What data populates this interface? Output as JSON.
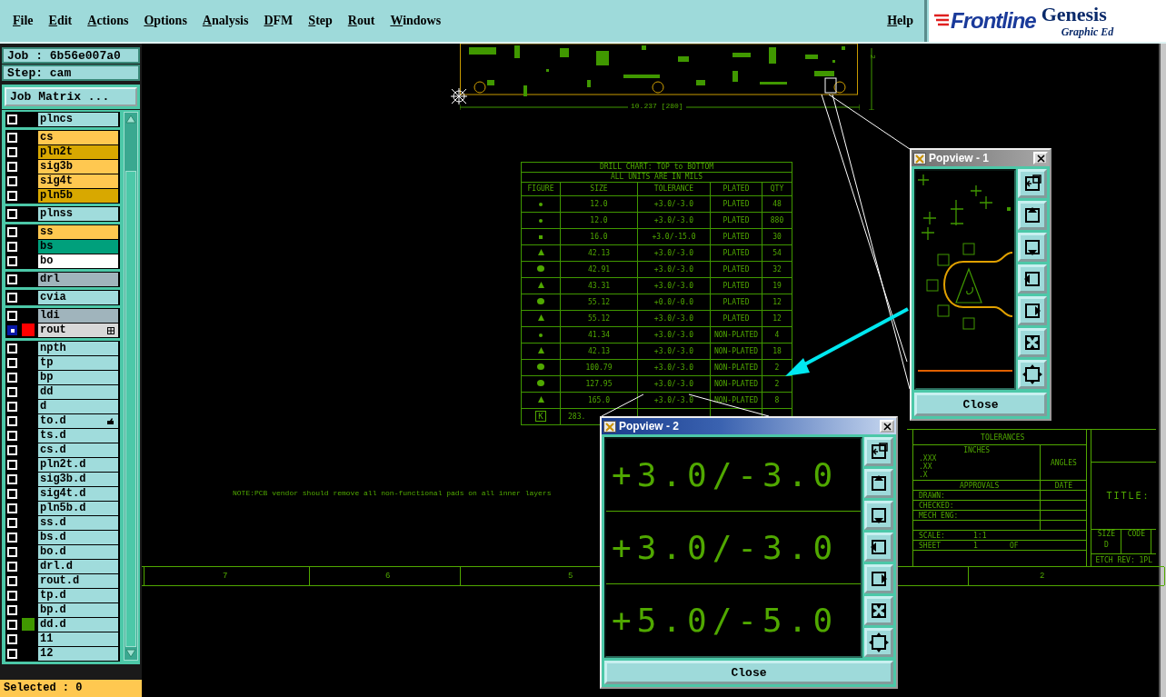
{
  "menu": {
    "items": [
      "File",
      "Edit",
      "Actions",
      "Options",
      "Analysis",
      "DFM",
      "Step",
      "Rout",
      "Windows"
    ],
    "help": "Help"
  },
  "logo": {
    "brand": "Frontline",
    "product": "Genesis",
    "subtitle": "Graphic Ed"
  },
  "job": {
    "job": "Job : 6b56e007a0",
    "step": "Step: cam",
    "matrix_button": "Job Matrix ..."
  },
  "layer_groups": [
    {
      "layers": [
        {
          "name": "plncs",
          "color": "#a0dcdc",
          "active": false
        }
      ]
    },
    {
      "layers": [
        {
          "name": "cs",
          "color": "#ffc850",
          "active": false
        },
        {
          "name": "pln2t",
          "color": "#d8a800",
          "active": false
        },
        {
          "name": "sig3b",
          "color": "#ffc850",
          "active": false
        },
        {
          "name": "sig4t",
          "color": "#ffc850",
          "active": false
        },
        {
          "name": "pln5b",
          "color": "#d8a800",
          "active": false
        }
      ]
    },
    {
      "layers": [
        {
          "name": "plnss",
          "color": "#a0dcdc",
          "active": false
        }
      ]
    },
    {
      "layers": [
        {
          "name": "ss",
          "color": "#ffc850",
          "active": false
        },
        {
          "name": "bs",
          "color": "#00a07c",
          "active": false
        },
        {
          "name": "bo",
          "color": "#ffffff",
          "active": false
        }
      ]
    },
    {
      "layers": [
        {
          "name": "drl",
          "color": "#a0b4bc",
          "active": false
        }
      ]
    },
    {
      "layers": [
        {
          "name": "cvia",
          "color": "#a0dcdc",
          "active": false
        }
      ]
    },
    {
      "layers": [
        {
          "name": "ldi",
          "color": "#a0b4bc",
          "active": false
        },
        {
          "name": "rout",
          "color": "#d8d8d8",
          "active": true,
          "swatch": {
            "color": "#ff0000"
          },
          "kind": "grid-mark"
        }
      ]
    },
    {
      "layers": [
        {
          "name": "npth",
          "color": "#a0dcdc",
          "active": false
        },
        {
          "name": "tp",
          "color": "#a0dcdc",
          "active": false
        },
        {
          "name": "bp",
          "color": "#a0dcdc",
          "active": false
        },
        {
          "name": "dd",
          "color": "#a0dcdc",
          "active": false
        },
        {
          "name": "d",
          "color": "#a0dcdc",
          "active": false
        },
        {
          "name": "to.d",
          "color": "#a0dcdc",
          "active": false,
          "kind": "hand-mark"
        },
        {
          "name": "ts.d",
          "color": "#a0dcdc",
          "active": false
        },
        {
          "name": "cs.d",
          "color": "#a0dcdc",
          "active": false
        },
        {
          "name": "pln2t.d",
          "color": "#a0dcdc",
          "active": false
        },
        {
          "name": "sig3b.d",
          "color": "#a0dcdc",
          "active": false
        },
        {
          "name": "sig4t.d",
          "color": "#a0dcdc",
          "active": false
        },
        {
          "name": "pln5b.d",
          "color": "#a0dcdc",
          "active": false
        },
        {
          "name": "ss.d",
          "color": "#a0dcdc",
          "active": false
        },
        {
          "name": "bs.d",
          "color": "#a0dcdc",
          "active": false
        },
        {
          "name": "bo.d",
          "color": "#a0dcdc",
          "active": false
        },
        {
          "name": "drl.d",
          "color": "#a0dcdc",
          "active": false
        },
        {
          "name": "rout.d",
          "color": "#a0dcdc",
          "active": false
        },
        {
          "name": "tp.d",
          "color": "#a0dcdc",
          "active": false
        },
        {
          "name": "bp.d",
          "color": "#a0dcdc",
          "active": false
        },
        {
          "name": "dd.d",
          "color": "#a0dcdc",
          "active": false,
          "swatch": {
            "color": "#409800"
          }
        },
        {
          "name": "11",
          "color": "#a0dcdc",
          "active": false
        },
        {
          "name": "12",
          "color": "#a0dcdc",
          "active": false
        }
      ]
    }
  ],
  "selected_status": "Selected : 0",
  "board": {
    "dimension": "10.237 [280]",
    "side_label": "2"
  },
  "drill_chart": {
    "title": "DRILL CHART: TOP to BOTTOM",
    "subtitle": "ALL UNITS ARE IN MILS",
    "columns": [
      "FIGURE",
      "SIZE",
      "TOLERANCE",
      "PLATED",
      "QTY"
    ],
    "rows": [
      {
        "kind": "small-dot",
        "size": "12.0",
        "tolerance": "+3.0/-3.0",
        "plated": "PLATED",
        "qty": "48"
      },
      {
        "kind": "small-dot",
        "size": "12.0",
        "tolerance": "+3.0/-3.0",
        "plated": "PLATED",
        "qty": "880"
      },
      {
        "kind": "square",
        "size": "16.0",
        "tolerance": "+3.0/-15.0",
        "plated": "PLATED",
        "qty": "30"
      },
      {
        "kind": "triangle",
        "size": "42.13",
        "tolerance": "+3.0/-3.0",
        "plated": "PLATED",
        "qty": "54"
      },
      {
        "kind": "blob",
        "size": "42.91",
        "tolerance": "+3.0/-3.0",
        "plated": "PLATED",
        "qty": "32"
      },
      {
        "kind": "triangle",
        "size": "43.31",
        "tolerance": "+3.0/-3.0",
        "plated": "PLATED",
        "qty": "19"
      },
      {
        "kind": "blob",
        "size": "55.12",
        "tolerance": "+0.0/-0.0",
        "plated": "PLATED",
        "qty": "12"
      },
      {
        "kind": "triangle",
        "size": "55.12",
        "tolerance": "+3.0/-3.0",
        "plated": "PLATED",
        "qty": "12"
      },
      {
        "kind": "small-dot",
        "size": "41.34",
        "tolerance": "+3.0/-3.0",
        "plated": "NON-PLATED",
        "qty": "4"
      },
      {
        "kind": "triangle",
        "size": "42.13",
        "tolerance": "+3.0/-3.0",
        "plated": "NON-PLATED",
        "qty": "18"
      },
      {
        "kind": "blob",
        "size": "100.79",
        "tolerance": "+3.0/-3.0",
        "plated": "NON-PLATED",
        "qty": "2"
      },
      {
        "kind": "blob",
        "size": "127.95",
        "tolerance": "+3.0/-3.0",
        "plated": "NON-PLATED",
        "qty": "2"
      },
      {
        "kind": "triangle",
        "size": "165.0",
        "tolerance": "+3.0/-3.0",
        "plated": "NON-PLATED",
        "qty": "8"
      },
      {
        "kind": "letter",
        "figure_text": "K",
        "size": "283."
      }
    ]
  },
  "note": "NOTE:PCB vendor should remove all non-functional pads on all inner layers",
  "title_block": {
    "heading": "TOLERANCES",
    "inches_label": "INCHES",
    "angles_label": "ANGLES",
    "tolerance_rows": [
      ".XXX",
      ".XX",
      ".X"
    ],
    "approvals_label": "APPROVALS",
    "date_label": "DATE",
    "approvers": [
      "DRAWN:",
      "CHECKED:",
      "MECH ENG:"
    ],
    "scale_label": "SCALE:",
    "scale": "1:1",
    "sheet_label": "SHEET",
    "sheet": "1",
    "of_label": "OF",
    "title_label": "TITLE:",
    "size_label": "SIZE",
    "code_label": "CODE",
    "size": "D",
    "etch_rev": "ETCH REV: 1PL"
  },
  "ruler": {
    "labels": [
      "7",
      "6",
      "5",
      "2"
    ]
  },
  "popviews": [
    {
      "kind": "board-detail",
      "title": "Popview - 1",
      "close_label": "Close"
    },
    {
      "kind": "text-zoom",
      "title": "Popview - 2",
      "close_label": "Close",
      "lines": [
        "+3.0/-3.0",
        "+3.0/-3.0",
        "+5.0/-5.0"
      ]
    }
  ]
}
